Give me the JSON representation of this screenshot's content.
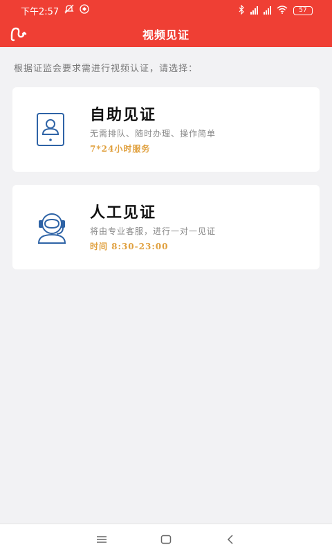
{
  "status_bar": {
    "time": "下午2:57",
    "battery": "57"
  },
  "header": {
    "title": "视频见证"
  },
  "prompt": "根据证监会要求需进行视频认证，请选择：",
  "options": [
    {
      "title": "自助见证",
      "description": "无需排队、随时办理、操作简单",
      "hours": "7*24小时服务",
      "icon": "tablet-user-icon"
    },
    {
      "title": "人工见证",
      "description": "将由专业客服，进行一对一见证",
      "hours": "时间 8:30-23:00",
      "icon": "headset-agent-icon"
    }
  ],
  "colors": {
    "accent": "#ef3f34",
    "highlight": "#e0a03e",
    "icon": "#2e63a6"
  }
}
